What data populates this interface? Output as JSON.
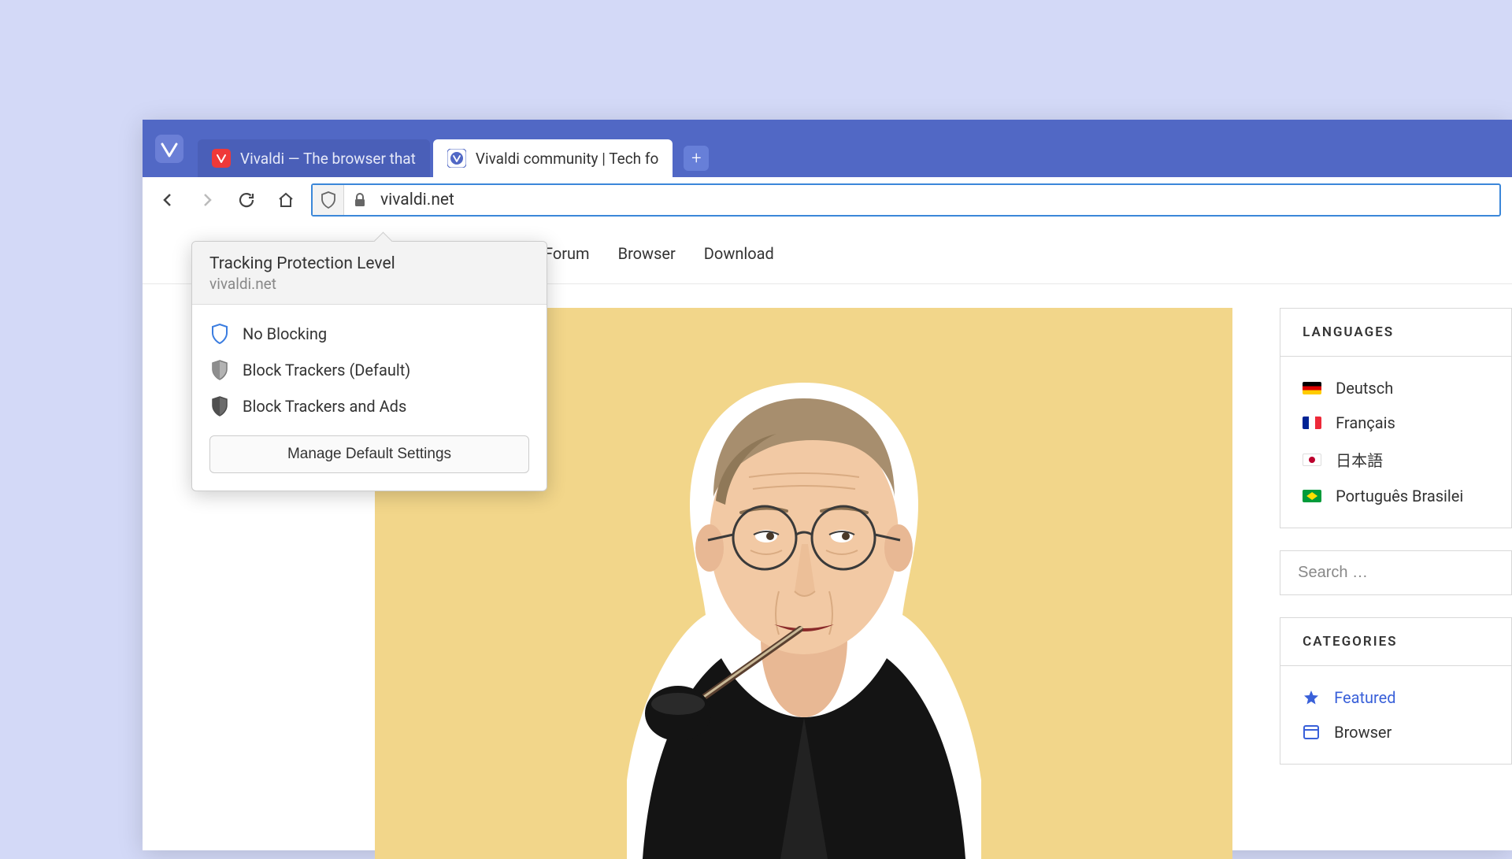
{
  "tabs": [
    {
      "label": "Vivaldi — The browser that",
      "active": false
    },
    {
      "label": "Vivaldi community | Tech fo",
      "active": true
    }
  ],
  "address_bar": {
    "url": "vivaldi.net"
  },
  "tracking_popup": {
    "title": "Tracking Protection Level",
    "subtitle": "vivaldi.net",
    "options": [
      {
        "label": "No Blocking",
        "shield": "outline-blue"
      },
      {
        "label": "Block Trackers (Default)",
        "shield": "grey"
      },
      {
        "label": "Block Trackers and Ads",
        "shield": "dark"
      }
    ],
    "manage_button": "Manage Default Settings"
  },
  "site_nav": [
    "Forum",
    "Browser",
    "Download"
  ],
  "sidebar": {
    "languages_title": "LANGUAGES",
    "languages": [
      {
        "label": "Deutsch",
        "flag": "de"
      },
      {
        "label": "Français",
        "flag": "fr"
      },
      {
        "label": "日本語",
        "flag": "jp"
      },
      {
        "label": "Português Brasilei",
        "flag": "br"
      }
    ],
    "search_placeholder": "Search …",
    "categories_title": "CATEGORIES",
    "categories": [
      {
        "label": "Featured",
        "icon": "star",
        "featured": true
      },
      {
        "label": "Browser",
        "icon": "window",
        "featured": false
      }
    ]
  }
}
